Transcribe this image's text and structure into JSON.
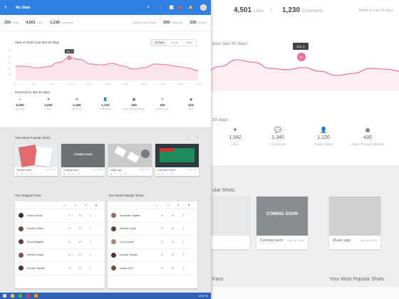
{
  "app": {
    "title": "My Stats",
    "notif_count": "3"
  },
  "summary": {
    "shots": {
      "value": "150",
      "label": "Shots"
    },
    "likes": {
      "value": "4,501",
      "label": "Likes"
    },
    "comments": {
      "value": "1,230",
      "label": "Comments"
    },
    "since": "Made in Last 30 days",
    "m1": {
      "value": "200",
      "label": "Rebounds"
    },
    "m2": {
      "value": "230",
      "label": "Buckets"
    }
  },
  "chart_panel": {
    "title": "View of shots your last 30 days",
    "toggle": [
      "30 Days",
      "6 Mos.",
      "Yearly"
    ],
    "peak": "JUL 4",
    "peak_value": "76",
    "chart_data": {
      "type": "area",
      "series": [
        {
          "values": [
            48,
            47,
            42,
            46,
            60,
            76,
            70,
            55,
            52,
            57,
            48,
            38,
            43,
            55,
            53,
            47,
            42,
            33
          ]
        }
      ],
      "ylim": [
        0,
        100
      ],
      "x_ticks": [
        "Jul 1",
        "Jul 4",
        "Jul 7",
        "Jul 10",
        "Jul 13",
        "Jul 16",
        "Jul 19",
        "Jul 22",
        "Jul 25",
        "Jul 28",
        "Jul 31"
      ],
      "y_ticks": [
        "100",
        "80",
        "60",
        "40",
        "20"
      ]
    }
  },
  "received": {
    "title": "Received in last 30 days",
    "items": [
      {
        "icon": "shots-icon",
        "value": "5,200",
        "label": "Shot Likes"
      },
      {
        "icon": "heart-icon",
        "value": "1,542",
        "label": "Likes"
      },
      {
        "icon": "comment-icon",
        "value": "1,340",
        "label": "Comments"
      },
      {
        "icon": "person-icon",
        "value": "1,120",
        "label": "Profile Views"
      },
      {
        "icon": "image-icon",
        "value": "430",
        "label": "Views Through Website"
      },
      {
        "icon": "pin-icon",
        "value": "120",
        "label": "Buckets Lists"
      },
      {
        "icon": "eye-icon",
        "value": "412",
        "label": "Views"
      }
    ]
  },
  "popular": {
    "title": "Your Most Popular Shots",
    "cards": [
      {
        "name": "Thread home",
        "date": "July 28, 2015",
        "bg": "#e9ecef",
        "views": "52",
        "comments": "12",
        "likes": "80"
      },
      {
        "name": "Coming soon",
        "date": "July 28, 2015",
        "bg": "#6e7072",
        "overlay": "COMING SOON",
        "views": "52",
        "comments": "12",
        "likes": "80"
      },
      {
        "name": "Music app",
        "date": "July 28, 2015",
        "bg": "#c8c8c8",
        "views": "52",
        "comments": "12",
        "likes": "80"
      },
      {
        "name": "Liverpool Player",
        "date": "July 28, 2015",
        "bg": "#2d3b3f",
        "views": "52",
        "comments": "12",
        "likes": "80"
      }
    ]
  },
  "fans": {
    "title": "Your Biggest Fans",
    "rows": [
      {
        "name": "Sudhir Kumar",
        "a": "12",
        "b": "15",
        "c": "4"
      },
      {
        "name": "Victoria Gilbert",
        "a": "12",
        "b": "15",
        "c": "4"
      },
      {
        "name": "Shiva Magadhi",
        "a": "12",
        "b": "15",
        "c": "4"
      },
      {
        "name": "Hemant Gupta",
        "a": "12",
        "b": "15",
        "c": "4"
      },
      {
        "name": "Avinash Tripathi",
        "a": "12",
        "b": "15",
        "c": "4"
      }
    ]
  },
  "shots_tbl": {
    "title": "Your Most Popular Shots",
    "rows": [
      {
        "name": "Alexander Zaytsev",
        "a": "12",
        "b": "15",
        "c": "4"
      },
      {
        "name": "Hemant Gupta",
        "a": "12",
        "b": "15",
        "c": "4"
      },
      {
        "name": "Lonut Zamfir",
        "a": "12",
        "b": "15",
        "c": "4"
      },
      {
        "name": "Avinash Tripathi",
        "a": "12",
        "b": "15",
        "c": "4"
      },
      {
        "name": "rakesh 1307",
        "a": "12",
        "b": "15",
        "c": "4"
      }
    ]
  },
  "taskbar": {
    "time": "10:02 PM"
  },
  "bg": {
    "likes": "4,501",
    "likes_lbl": "Likes",
    "comments": "1,230",
    "comments_lbl": "Comments",
    "made": "Made in Last 30 days",
    "chart_title": "your last 30 days",
    "peak": "JUL 4",
    "peak_value": "76",
    "days": "30 days",
    "stats": [
      {
        "icon": "heart",
        "v": "1,542",
        "s": "Likes"
      },
      {
        "icon": "comment",
        "v": "1,340",
        "s": "Comments"
      },
      {
        "icon": "person",
        "v": "1,120",
        "s": "Profile Views"
      },
      {
        "icon": "image",
        "v": "430",
        "s": "Views Through Website"
      }
    ],
    "popular": "ular Shots",
    "card1": "Coming soon",
    "card2": "Music app",
    "date": "July 28, 2015",
    "fans": "Fans",
    "shots": "Your Most Popular Shots"
  }
}
